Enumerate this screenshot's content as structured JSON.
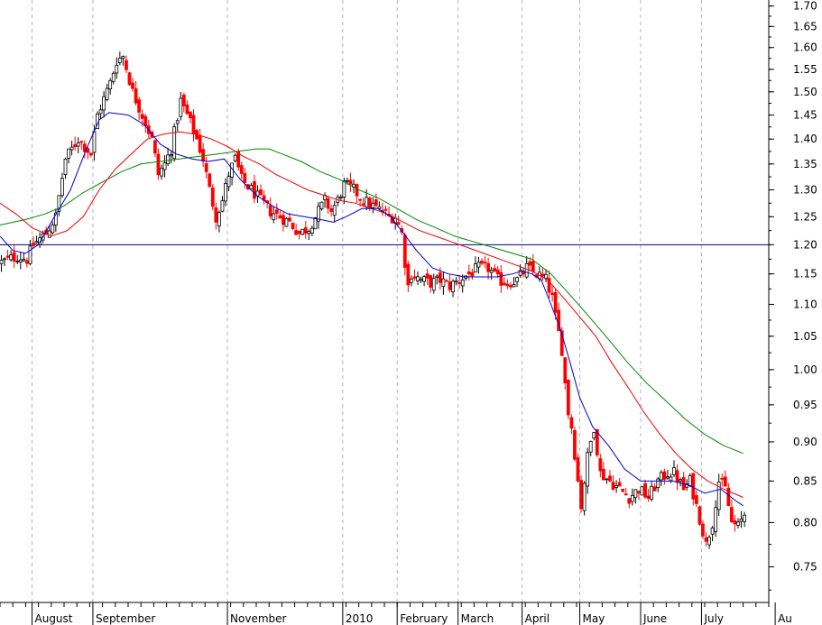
{
  "chart_data": {
    "type": "candlestick",
    "title": "",
    "xlabel": "",
    "ylabel": "",
    "ylim": [
      0.712,
      1.715
    ],
    "y_scale": "log",
    "y_ticks": [
      "1.70",
      "1.65",
      "1.60",
      "1.55",
      "1.50",
      "1.45",
      "1.40",
      "1.35",
      "1.30",
      "1.25",
      "1.20",
      "1.15",
      "1.10",
      "1.05",
      "1.00",
      "0.95",
      "0.90",
      "0.85",
      "0.80",
      "0.75"
    ],
    "x_ticks": [
      {
        "label": "August",
        "index": 10
      },
      {
        "label": "September",
        "index": 29
      },
      {
        "label": "November",
        "index": 71
      },
      {
        "label": "2010",
        "index": 107
      },
      {
        "label": "February",
        "index": 124
      },
      {
        "label": "March",
        "index": 143
      },
      {
        "label": "April",
        "index": 163
      },
      {
        "label": "May",
        "index": 181
      },
      {
        "label": "June",
        "index": 200
      },
      {
        "label": "July",
        "index": 219
      },
      {
        "label": "Au",
        "index": 242
      }
    ],
    "grid": true,
    "reference_line": 1.2,
    "colors": {
      "up": "#000000",
      "down": "#ff0000",
      "fast_ma": "#0000cc",
      "mid_ma": "#ee0000",
      "slow_ma": "#008800",
      "reference": "#000080",
      "grid": "#b4b4b4"
    },
    "series": [
      {
        "name": "",
        "ma": 10,
        "color": "#0000cc"
      },
      {
        "name": "",
        "ma": 30,
        "color": "#ee0000"
      },
      {
        "name": "",
        "ma": 65,
        "color": "#008800"
      }
    ],
    "trend_close": [
      [
        0,
        1.17
      ],
      [
        5,
        1.18
      ],
      [
        8,
        1.175
      ],
      [
        10,
        1.2
      ],
      [
        14,
        1.22
      ],
      [
        17,
        1.25
      ],
      [
        20,
        1.36
      ],
      [
        24,
        1.4
      ],
      [
        28,
        1.37
      ],
      [
        30,
        1.45
      ],
      [
        34,
        1.52
      ],
      [
        36,
        1.57
      ],
      [
        38,
        1.58
      ],
      [
        41,
        1.5
      ],
      [
        44,
        1.45
      ],
      [
        47,
        1.4
      ],
      [
        49,
        1.33
      ],
      [
        51,
        1.35
      ],
      [
        53,
        1.38
      ],
      [
        56,
        1.48
      ],
      [
        58,
        1.45
      ],
      [
        61,
        1.4
      ],
      [
        63,
        1.36
      ],
      [
        65,
        1.3
      ],
      [
        67,
        1.25
      ],
      [
        69,
        1.28
      ],
      [
        71,
        1.33
      ],
      [
        73,
        1.36
      ],
      [
        75,
        1.32
      ],
      [
        78,
        1.3
      ],
      [
        81,
        1.28
      ],
      [
        84,
        1.26
      ],
      [
        87,
        1.25
      ],
      [
        90,
        1.24
      ],
      [
        93,
        1.22
      ],
      [
        96,
        1.23
      ],
      [
        99,
        1.26
      ],
      [
        101,
        1.28
      ],
      [
        103,
        1.26
      ],
      [
        105,
        1.28
      ],
      [
        107,
        1.31
      ],
      [
        110,
        1.3
      ],
      [
        113,
        1.28
      ],
      [
        116,
        1.27
      ],
      [
        119,
        1.26
      ],
      [
        121,
        1.25
      ],
      [
        123,
        1.25
      ],
      [
        125,
        1.22
      ],
      [
        126,
        1.17
      ],
      [
        127,
        1.13
      ],
      [
        128,
        1.15
      ],
      [
        131,
        1.14
      ],
      [
        134,
        1.135
      ],
      [
        137,
        1.14
      ],
      [
        140,
        1.13
      ],
      [
        143,
        1.14
      ],
      [
        146,
        1.15
      ],
      [
        149,
        1.16
      ],
      [
        152,
        1.16
      ],
      [
        155,
        1.14
      ],
      [
        158,
        1.135
      ],
      [
        161,
        1.14
      ],
      [
        164,
        1.16
      ],
      [
        167,
        1.15
      ],
      [
        170,
        1.14
      ],
      [
        172,
        1.11
      ],
      [
        173,
        1.08
      ],
      [
        175,
        1.03
      ],
      [
        176,
        0.98
      ],
      [
        177,
        0.94
      ],
      [
        178,
        0.92
      ],
      [
        180,
        0.85
      ],
      [
        181,
        0.82
      ],
      [
        183,
        0.88
      ],
      [
        185,
        0.92
      ],
      [
        187,
        0.86
      ],
      [
        190,
        0.85
      ],
      [
        193,
        0.84
      ],
      [
        196,
        0.83
      ],
      [
        199,
        0.84
      ],
      [
        202,
        0.83
      ],
      [
        205,
        0.85
      ],
      [
        208,
        0.86
      ],
      [
        210,
        0.86
      ],
      [
        213,
        0.84
      ],
      [
        215,
        0.85
      ],
      [
        217,
        0.82
      ],
      [
        219,
        0.79
      ],
      [
        220,
        0.775
      ],
      [
        222,
        0.8
      ],
      [
        224,
        0.85
      ],
      [
        226,
        0.84
      ],
      [
        228,
        0.8
      ],
      [
        230,
        0.795
      ],
      [
        232,
        0.81
      ]
    ],
    "moving_averages": {
      "fast_ma": [
        [
          0,
          1.215
        ],
        [
          4,
          1.19
        ],
        [
          8,
          1.185
        ],
        [
          12,
          1.2
        ],
        [
          16,
          1.24
        ],
        [
          22,
          1.3
        ],
        [
          27,
          1.38
        ],
        [
          31,
          1.44
        ],
        [
          34,
          1.455
        ],
        [
          40,
          1.45
        ],
        [
          45,
          1.43
        ],
        [
          50,
          1.39
        ],
        [
          55,
          1.37
        ],
        [
          60,
          1.36
        ],
        [
          65,
          1.355
        ],
        [
          70,
          1.36
        ],
        [
          75,
          1.32
        ],
        [
          80,
          1.29
        ],
        [
          85,
          1.27
        ],
        [
          90,
          1.255
        ],
        [
          95,
          1.25
        ],
        [
          100,
          1.245
        ],
        [
          104,
          1.24
        ],
        [
          108,
          1.25
        ],
        [
          113,
          1.265
        ],
        [
          118,
          1.265
        ],
        [
          122,
          1.25
        ],
        [
          126,
          1.22
        ],
        [
          130,
          1.19
        ],
        [
          135,
          1.16
        ],
        [
          140,
          1.15
        ],
        [
          145,
          1.145
        ],
        [
          150,
          1.145
        ],
        [
          155,
          1.145
        ],
        [
          160,
          1.15
        ],
        [
          163,
          1.155
        ],
        [
          166,
          1.15
        ],
        [
          169,
          1.14
        ],
        [
          172,
          1.1
        ],
        [
          175,
          1.06
        ],
        [
          178,
          1.01
        ],
        [
          181,
          0.96
        ],
        [
          185,
          0.92
        ],
        [
          190,
          0.895
        ],
        [
          195,
          0.865
        ],
        [
          200,
          0.85
        ],
        [
          205,
          0.85
        ],
        [
          210,
          0.85
        ],
        [
          215,
          0.845
        ],
        [
          220,
          0.835
        ],
        [
          225,
          0.84
        ],
        [
          230,
          0.825
        ],
        [
          232,
          0.82
        ]
      ],
      "mid_ma": [
        [
          0,
          1.275
        ],
        [
          5,
          1.255
        ],
        [
          10,
          1.23
        ],
        [
          16,
          1.215
        ],
        [
          21,
          1.225
        ],
        [
          26,
          1.25
        ],
        [
          31,
          1.3
        ],
        [
          36,
          1.34
        ],
        [
          41,
          1.37
        ],
        [
          46,
          1.4
        ],
        [
          51,
          1.41
        ],
        [
          56,
          1.415
        ],
        [
          61,
          1.41
        ],
        [
          66,
          1.4
        ],
        [
          71,
          1.385
        ],
        [
          76,
          1.365
        ],
        [
          81,
          1.35
        ],
        [
          86,
          1.33
        ],
        [
          91,
          1.315
        ],
        [
          96,
          1.3
        ],
        [
          101,
          1.29
        ],
        [
          106,
          1.28
        ],
        [
          111,
          1.275
        ],
        [
          116,
          1.265
        ],
        [
          121,
          1.255
        ],
        [
          126,
          1.24
        ],
        [
          131,
          1.225
        ],
        [
          136,
          1.215
        ],
        [
          141,
          1.205
        ],
        [
          146,
          1.195
        ],
        [
          151,
          1.185
        ],
        [
          156,
          1.175
        ],
        [
          161,
          1.165
        ],
        [
          166,
          1.155
        ],
        [
          171,
          1.14
        ],
        [
          176,
          1.11
        ],
        [
          181,
          1.08
        ],
        [
          186,
          1.05
        ],
        [
          191,
          1.01
        ],
        [
          196,
          0.975
        ],
        [
          201,
          0.94
        ],
        [
          206,
          0.91
        ],
        [
          211,
          0.885
        ],
        [
          216,
          0.865
        ],
        [
          221,
          0.85
        ],
        [
          226,
          0.84
        ],
        [
          232,
          0.83
        ]
      ],
      "slow_ma": [
        [
          0,
          1.235
        ],
        [
          8,
          1.245
        ],
        [
          14,
          1.255
        ],
        [
          20,
          1.27
        ],
        [
          26,
          1.295
        ],
        [
          32,
          1.315
        ],
        [
          38,
          1.335
        ],
        [
          44,
          1.35
        ],
        [
          50,
          1.355
        ],
        [
          56,
          1.36
        ],
        [
          62,
          1.365
        ],
        [
          68,
          1.37
        ],
        [
          74,
          1.375
        ],
        [
          80,
          1.38
        ],
        [
          84,
          1.38
        ],
        [
          88,
          1.37
        ],
        [
          94,
          1.355
        ],
        [
          100,
          1.335
        ],
        [
          106,
          1.32
        ],
        [
          112,
          1.3
        ],
        [
          118,
          1.285
        ],
        [
          124,
          1.265
        ],
        [
          130,
          1.245
        ],
        [
          136,
          1.23
        ],
        [
          142,
          1.215
        ],
        [
          148,
          1.205
        ],
        [
          154,
          1.195
        ],
        [
          160,
          1.185
        ],
        [
          166,
          1.175
        ],
        [
          172,
          1.15
        ],
        [
          178,
          1.115
        ],
        [
          184,
          1.08
        ],
        [
          190,
          1.045
        ],
        [
          196,
          1.01
        ],
        [
          202,
          0.98
        ],
        [
          208,
          0.955
        ],
        [
          214,
          0.93
        ],
        [
          220,
          0.91
        ],
        [
          226,
          0.895
        ],
        [
          232,
          0.885
        ]
      ]
    }
  }
}
